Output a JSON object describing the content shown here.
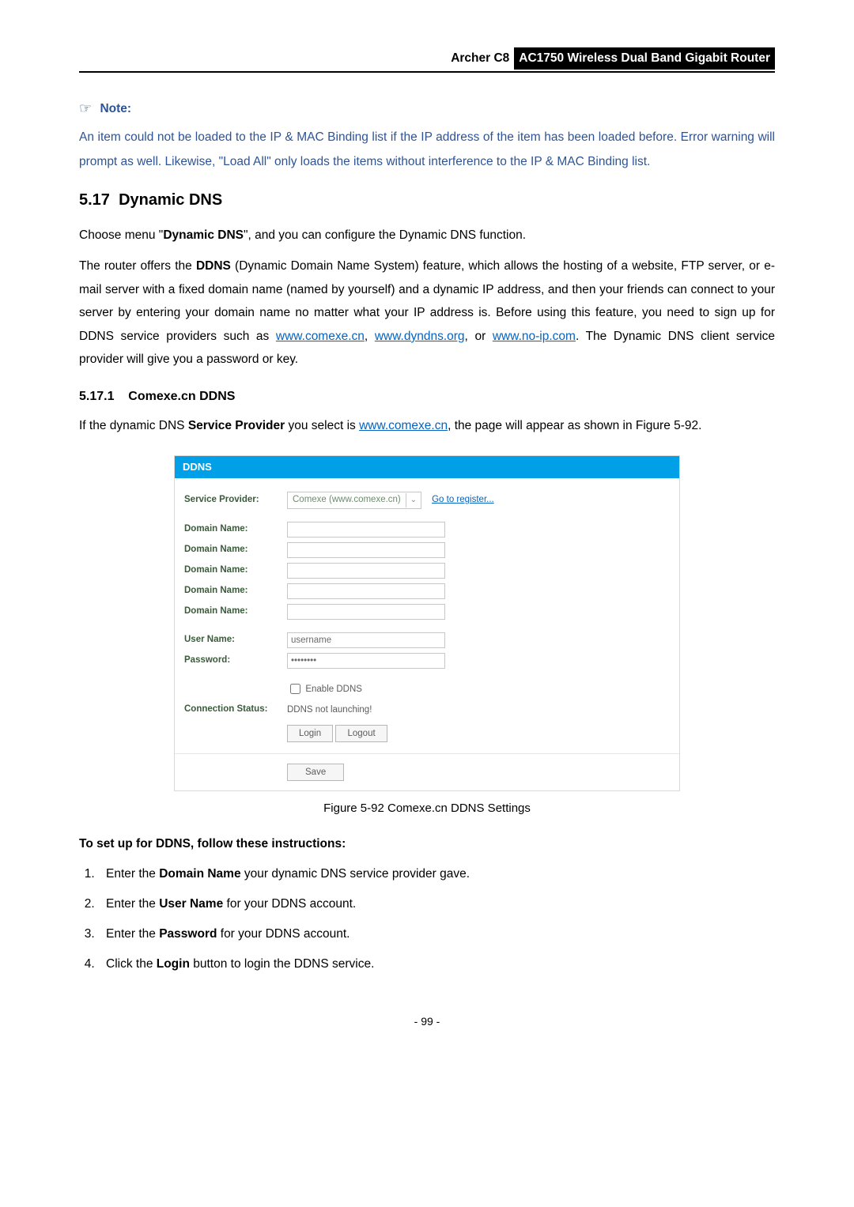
{
  "header": {
    "model": "Archer C8",
    "product": "AC1750 Wireless Dual Band Gigabit Router"
  },
  "note": {
    "label": "Note:",
    "text": "An item could not be loaded to the IP & MAC Binding list if the IP address of the item has been loaded before. Error warning will prompt as well. Likewise, \"Load All\" only loads the items without interference to the IP & MAC Binding list."
  },
  "section": {
    "num": "5.17",
    "title": "Dynamic DNS"
  },
  "para1_a": "Choose menu \"",
  "para1_b": "Dynamic DNS",
  "para1_c": "\", and you can configure the Dynamic DNS function.",
  "para2_a": "The router offers the ",
  "para2_b": "DDNS",
  "para2_c": " (Dynamic Domain Name System) feature, which allows the hosting of a website, FTP server, or e-mail server with a fixed domain name (named by yourself) and a dynamic IP address, and then your friends can connect to your server by entering your domain name no matter what your IP address is. Before using this feature, you need to sign up for DDNS service providers such as ",
  "para2_link1": "www.comexe.cn",
  "para2_d": ", ",
  "para2_link2": "www.dyndns.org",
  "para2_e": ", or ",
  "para2_link3": "www.no-ip.com",
  "para2_f": ". The Dynamic DNS client service provider will give you a password or key.",
  "subsection": {
    "num": "5.17.1",
    "title": "Comexe.cn DDNS"
  },
  "para3_a": "If the dynamic DNS ",
  "para3_b": "Service Provider",
  "para3_c": " you select is ",
  "para3_link": "www.comexe.cn",
  "para3_d": ", the page will appear as shown in Figure 5-92.",
  "figure": {
    "card_title": "DDNS",
    "labels": {
      "service_provider": "Service Provider:",
      "domain_name": "Domain Name:",
      "user_name": "User Name:",
      "password": "Password:",
      "connection_status": "Connection Status:"
    },
    "provider_value": "Comexe (www.comexe.cn)",
    "register_link": "Go to register...",
    "user_name_value": "username",
    "password_value": "••••••••",
    "enable_label": "Enable DDNS",
    "status_value": "DDNS not launching!",
    "login_btn": "Login",
    "logout_btn": "Logout",
    "save_btn": "Save"
  },
  "caption": "Figure 5-92 Comexe.cn DDNS Settings",
  "instructions": {
    "heading": "To set up for DDNS, follow these instructions:",
    "items": [
      {
        "a": "Enter the ",
        "b": "Domain Name",
        "c": " your dynamic DNS service provider gave."
      },
      {
        "a": "Enter the ",
        "b": "User Name",
        "c": " for your DDNS account."
      },
      {
        "a": "Enter the ",
        "b": "Password",
        "c": " for your DDNS account."
      },
      {
        "a": "Click the ",
        "b": "Login",
        "c": " button to login the DDNS service."
      }
    ]
  },
  "page_number": "- 99 -"
}
